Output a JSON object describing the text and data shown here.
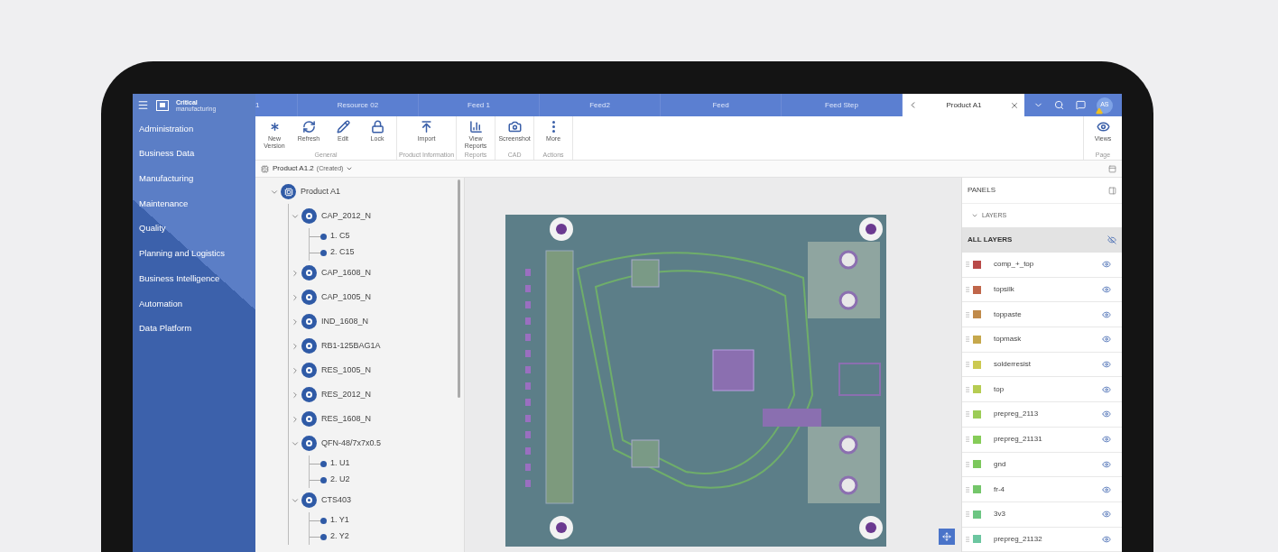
{
  "sidebar": {
    "logo": {
      "line1": "Critical",
      "line2": "manufacturing"
    },
    "items": [
      {
        "label": "Administration"
      },
      {
        "label": "Business Data"
      },
      {
        "label": "Manufacturing"
      },
      {
        "label": "Maintenance"
      },
      {
        "label": "Quality"
      },
      {
        "label": "Planning and Logistics"
      },
      {
        "label": "Business Intelligence"
      },
      {
        "label": "Automation"
      },
      {
        "label": "Data Platform"
      }
    ]
  },
  "tabs": [
    {
      "label": "1",
      "selected": false
    },
    {
      "label": "Resource 02",
      "selected": false
    },
    {
      "label": "Feed 1",
      "selected": false
    },
    {
      "label": "Feed2",
      "selected": false
    },
    {
      "label": "Feed",
      "selected": false
    },
    {
      "label": "Feed Step",
      "selected": false
    },
    {
      "label": "Product A1",
      "selected": true
    }
  ],
  "user": {
    "initials": "AS",
    "warning": true
  },
  "toolbar": {
    "groups": [
      {
        "label": "General",
        "buttons": [
          {
            "label": "New Version"
          },
          {
            "label": "Refresh"
          },
          {
            "label": "Edit"
          },
          {
            "label": "Lock"
          }
        ]
      },
      {
        "label": "Product Information",
        "buttons": [
          {
            "label": "Import"
          }
        ]
      },
      {
        "label": "Reports",
        "buttons": [
          {
            "label": "View Reports"
          }
        ]
      },
      {
        "label": "CAD",
        "buttons": [
          {
            "label": "Screenshot"
          }
        ]
      },
      {
        "label": "Actions",
        "buttons": [
          {
            "label": "More"
          }
        ]
      }
    ],
    "right_group": {
      "label": "Page",
      "buttons": [
        {
          "label": "Views"
        }
      ]
    }
  },
  "breadcrumb": {
    "title": "Product A1.2",
    "status": "(Created)"
  },
  "tree": {
    "label": "Product A1",
    "kind": "product",
    "expanded": true,
    "children": [
      {
        "label": "CAP_2012_N",
        "kind": "part",
        "expanded": true,
        "children": [
          {
            "label": "1. C5",
            "kind": "item"
          },
          {
            "label": "2. C15",
            "kind": "item"
          }
        ]
      },
      {
        "label": "CAP_1608_N",
        "kind": "part",
        "expanded": false
      },
      {
        "label": "CAP_1005_N",
        "kind": "part",
        "expanded": false
      },
      {
        "label": "IND_1608_N",
        "kind": "part",
        "expanded": false
      },
      {
        "label": "RB1-125BAG1A",
        "kind": "part",
        "expanded": false
      },
      {
        "label": "RES_1005_N",
        "kind": "part",
        "expanded": false
      },
      {
        "label": "RES_2012_N",
        "kind": "part",
        "expanded": false
      },
      {
        "label": "RES_1608_N",
        "kind": "part",
        "expanded": false
      },
      {
        "label": "QFN-48/7x7x0.5",
        "kind": "part",
        "expanded": true,
        "children": [
          {
            "label": "1. U1",
            "kind": "item"
          },
          {
            "label": "2. U2",
            "kind": "item"
          }
        ]
      },
      {
        "label": "CTS403",
        "kind": "part",
        "expanded": true,
        "children": [
          {
            "label": "1. Y1",
            "kind": "item"
          },
          {
            "label": "2. Y2",
            "kind": "item"
          }
        ]
      }
    ]
  },
  "panels": {
    "title": "PANELS",
    "section": "LAYERS",
    "section_expanded": true,
    "all_label": "ALL LAYERS",
    "all_visible": false,
    "layers": [
      {
        "name": "comp_+_top",
        "color": "#b94a48",
        "visible": true
      },
      {
        "name": "topsilk",
        "color": "#c0664a",
        "visible": true
      },
      {
        "name": "toppaste",
        "color": "#c08a4a",
        "visible": true
      },
      {
        "name": "topmask",
        "color": "#c6a84c",
        "visible": true
      },
      {
        "name": "solderresist",
        "color": "#ccc950",
        "visible": true
      },
      {
        "name": "top",
        "color": "#b6cc52",
        "visible": true
      },
      {
        "name": "prepreg_2113",
        "color": "#9ccc56",
        "visible": true
      },
      {
        "name": "prepreg_21131",
        "color": "#86cc58",
        "visible": true
      },
      {
        "name": "gnd",
        "color": "#7cc85c",
        "visible": true
      },
      {
        "name": "fr-4",
        "color": "#74c66a",
        "visible": true
      },
      {
        "name": "3v3",
        "color": "#6cc682",
        "visible": true
      },
      {
        "name": "prepreg_21132",
        "color": "#6cc6a0",
        "visible": true
      }
    ]
  }
}
